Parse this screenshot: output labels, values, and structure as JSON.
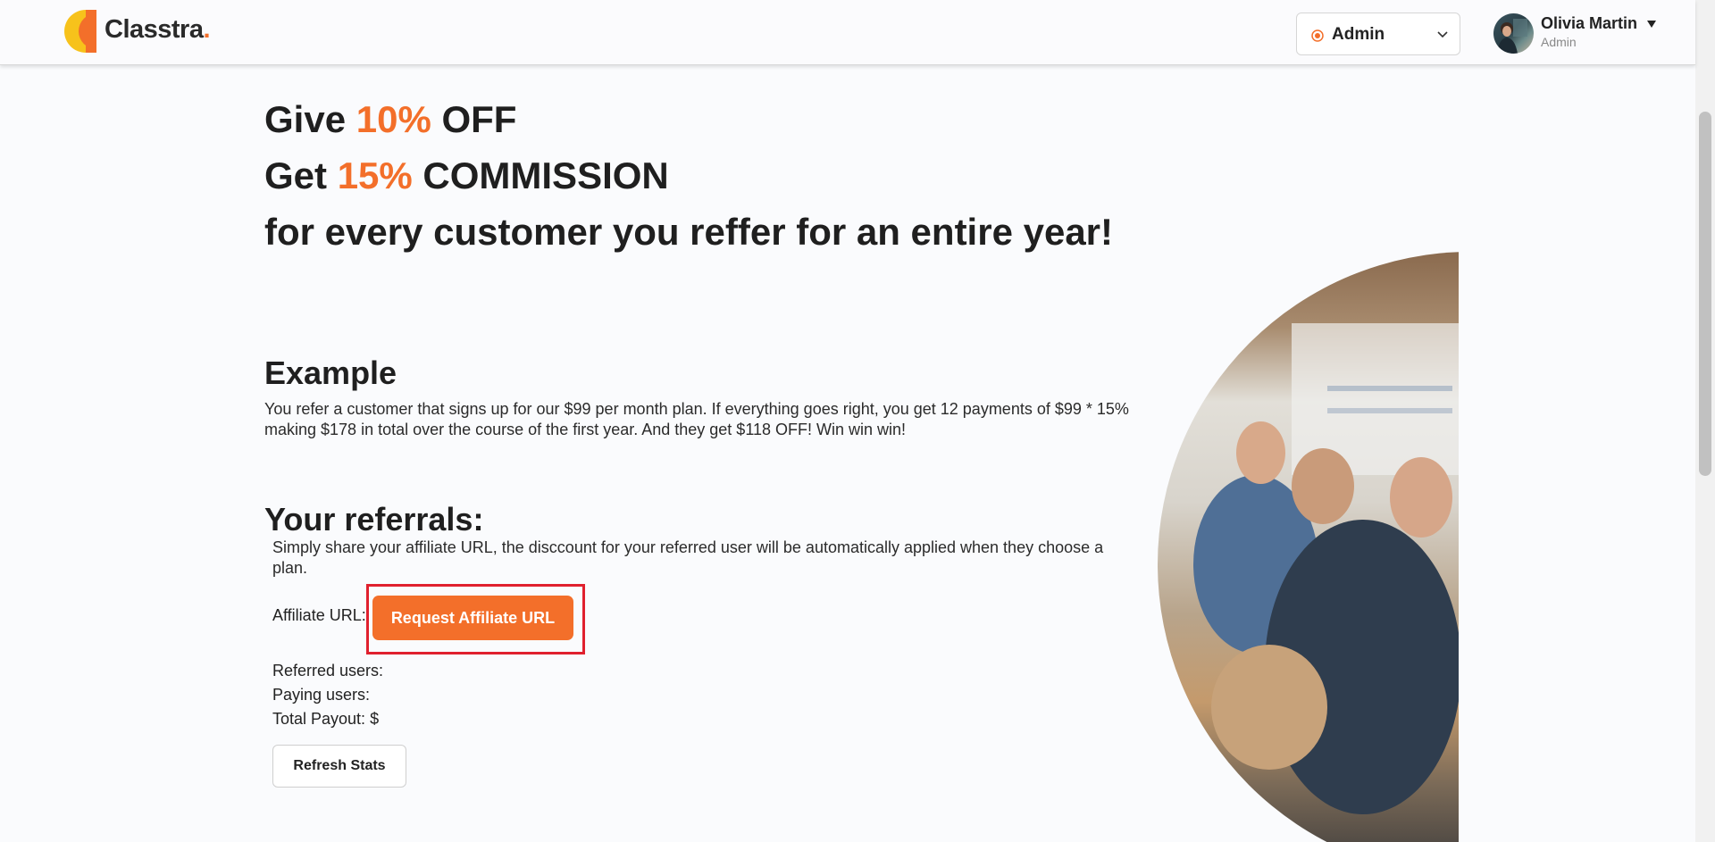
{
  "brand": {
    "name": "Classtra",
    "accent_dot": ".",
    "logo_colors": {
      "primary": "#f36f2a",
      "secondary": "#f7c21b"
    }
  },
  "header": {
    "role_select": {
      "value": "Admin",
      "icon": "radio-dot-icon"
    },
    "user": {
      "name": "Olivia Martin",
      "role": "Admin"
    }
  },
  "hero": {
    "line1": {
      "prefix": "Give ",
      "highlight": "10%",
      "suffix": " OFF"
    },
    "line2": {
      "prefix": "Get ",
      "highlight": "15%",
      "suffix": " COMMISSION"
    },
    "line3": "for every customer you reffer for an entire year!"
  },
  "example": {
    "title": "Example",
    "text": "You refer a customer that signs up for our $99 per month plan. If everything goes right, you get 12 payments of $99 * 15% making $178 in total over the course of the first year. And they get $118 OFF! Win win win!"
  },
  "referrals": {
    "title": "Your referrals:",
    "description": "Simply share your affiliate URL, the disccount for your referred user will be automatically applied when they choose a plan.",
    "affiliate_label": "Affiliate URL:",
    "request_button": "Request Affiliate URL",
    "referred_users_label": "Referred users:",
    "paying_users_label": "Paying users:",
    "total_payout_label": "Total Payout: $",
    "refresh_button": "Refresh Stats"
  },
  "colors": {
    "accent": "#f36f2a",
    "highlight_border": "#e0202e",
    "text": "#1f1f1f"
  }
}
